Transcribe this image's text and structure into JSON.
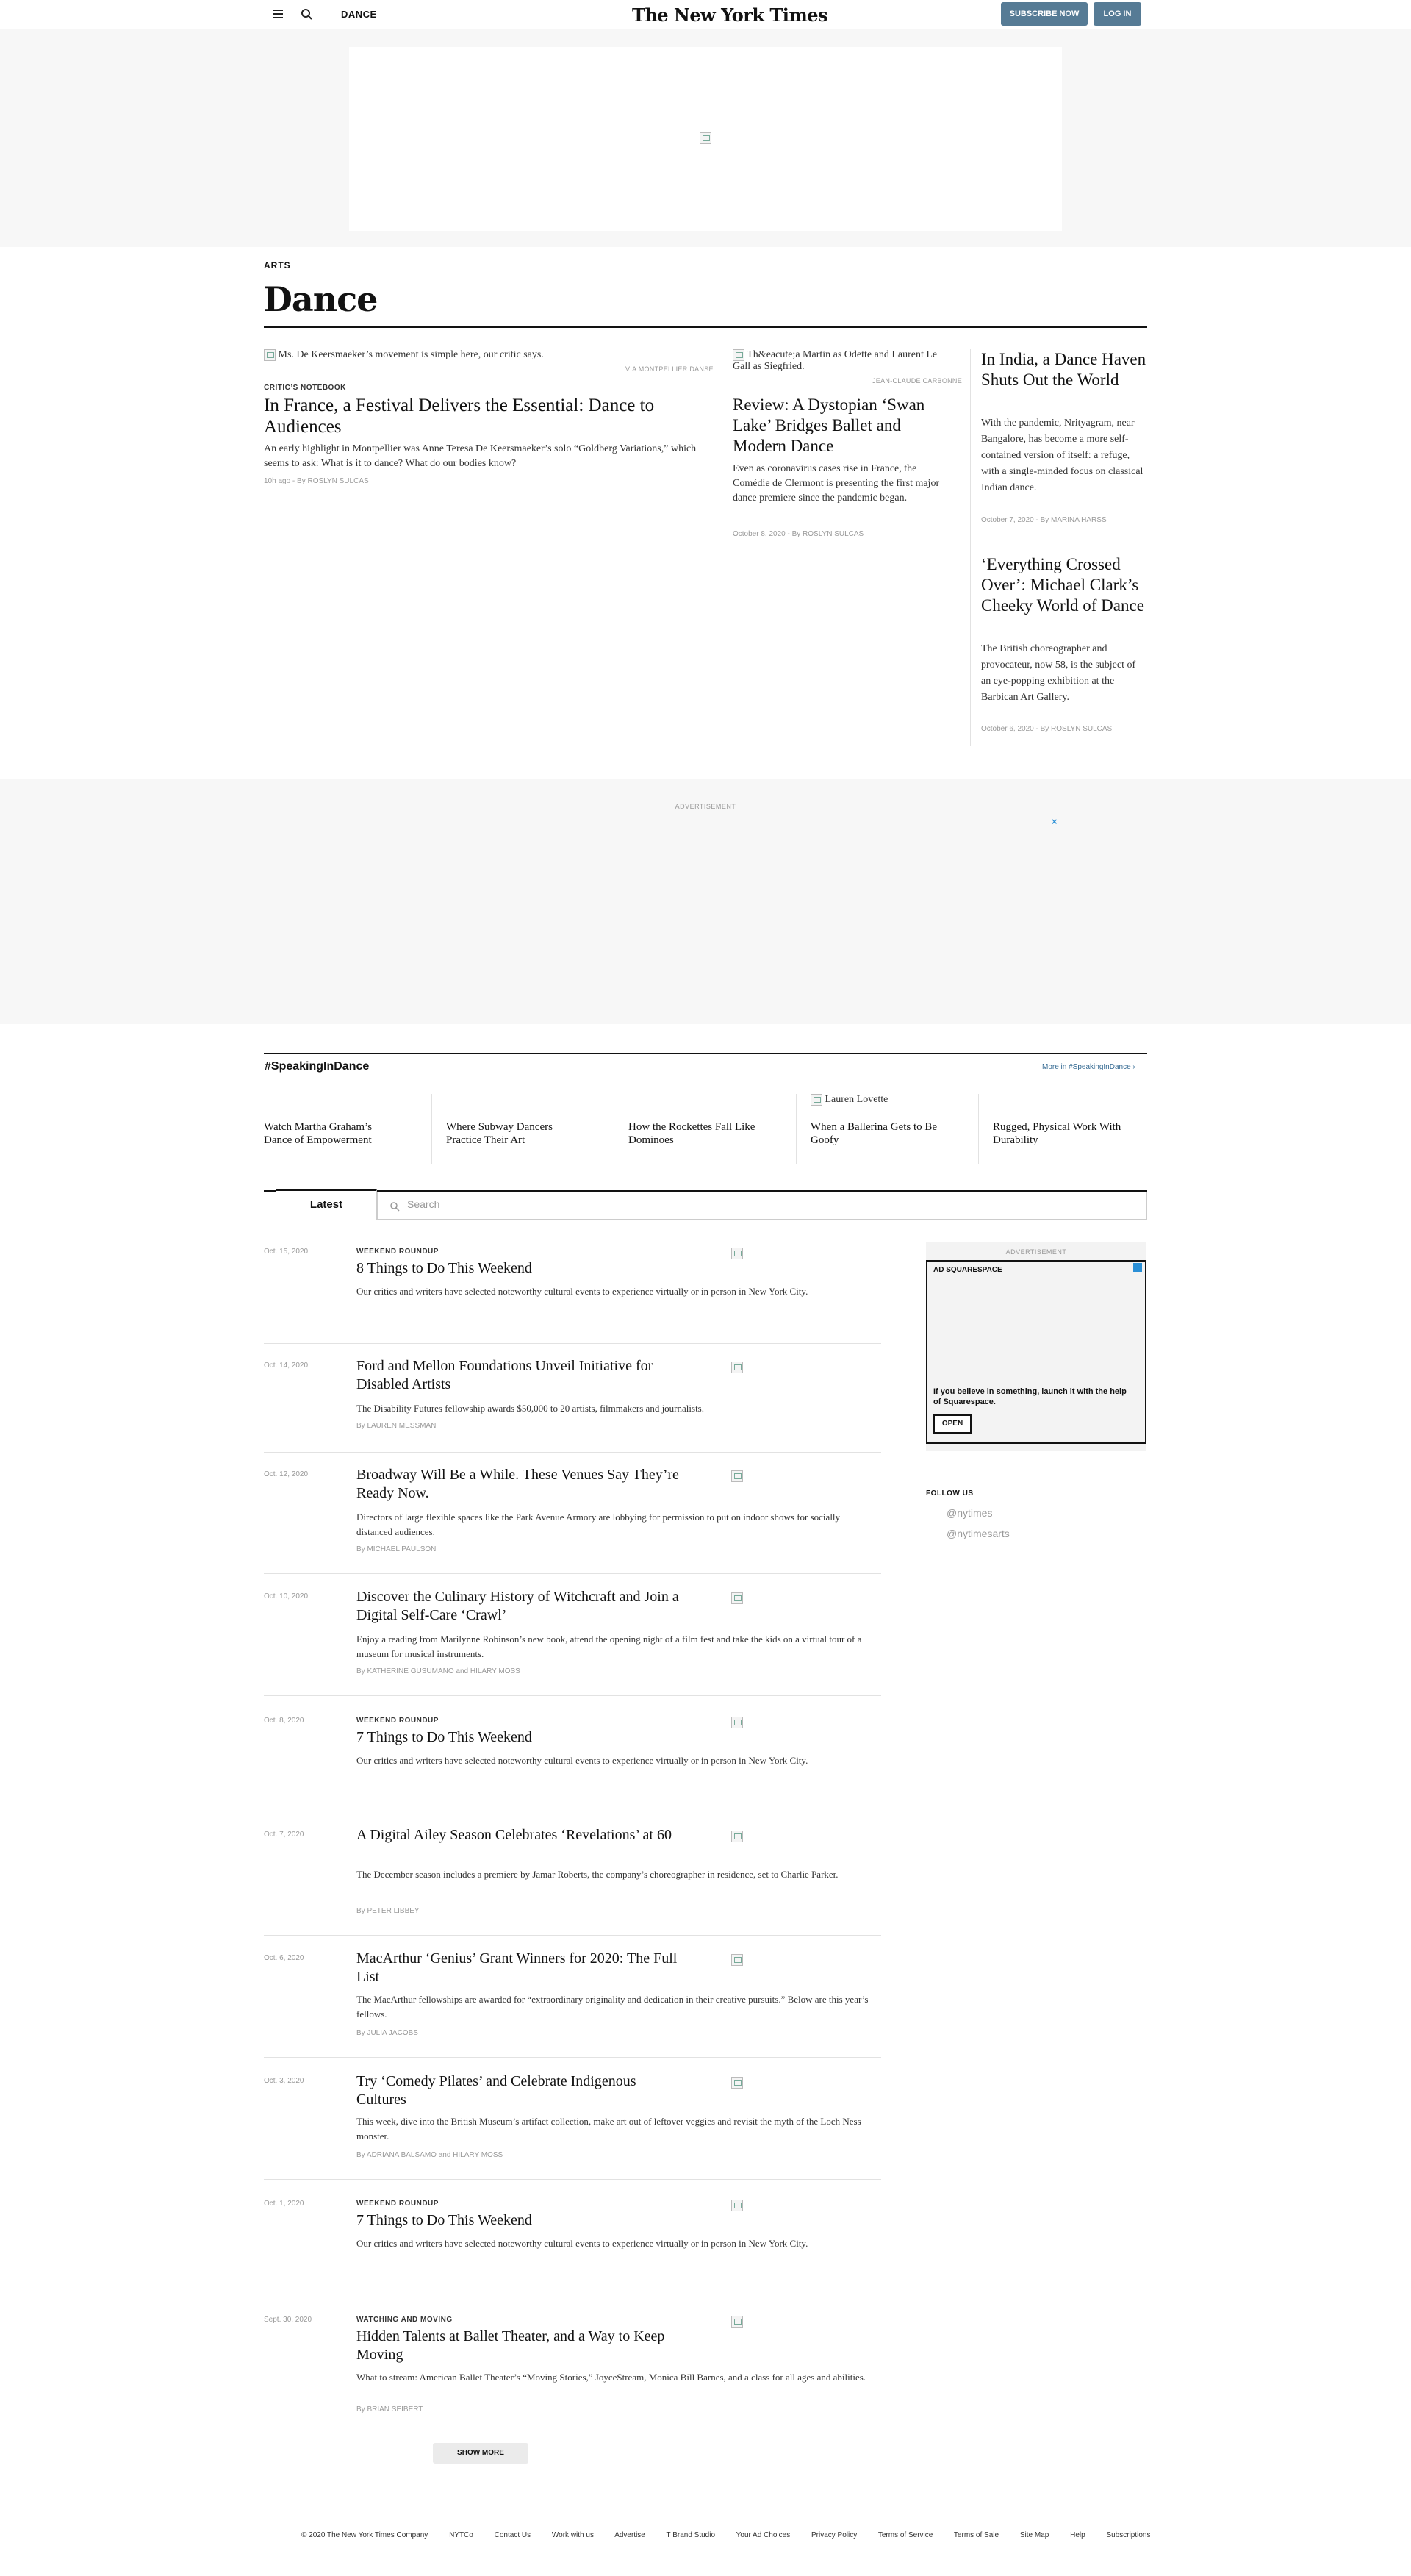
{
  "header": {
    "section": "DANCE",
    "logo": "The New York Times",
    "subscribe": "SUBSCRIBE NOW",
    "login": "LOG IN"
  },
  "page": {
    "kicker": "ARTS",
    "title": "Dance"
  },
  "lede": {
    "main": {
      "img_alt": "Ms. De Keersmaeker’s movement is simple here, our critic says.",
      "credit": "VIA MONTPELLIER DANSE",
      "label": "CRITIC’S NOTEBOOK",
      "title": "In France, a Festival Delivers the Essential: Dance to Audiences",
      "summary": "An early highlight in Montpellier was Anne Teresa De Keersmaeker’s solo “Goldberg Variations,” which seems to ask: What is it to dance? What do our bodies know?",
      "byline": "10h ago  -  By ROSLYN SULCAS"
    },
    "second": {
      "img_alt": "Th&eacute;a Martin as Odette and Laurent Le Gall as Siegfried.",
      "credit": "JEAN-CLAUDE CARBONNE",
      "title": "Review: A Dystopian ‘Swan Lake’ Bridges Ballet and Modern Dance",
      "summary": "Even as coronavirus cases rise in France, the Comédie de Clermont is presenting the first major dance premiere since the pandemic began.",
      "byline": "October 8, 2020  -  By ROSLYN SULCAS"
    },
    "third": {
      "title": "In India, a Dance Haven Shuts Out the World",
      "summary": "With the pandemic, Nrityagram, near Bangalore, has become a more self-contained version of itself: a refuge, with a single-minded focus on classical Indian dance.",
      "byline": "October 7, 2020  -  By MARINA HARSS"
    },
    "fourth": {
      "title": "‘Everything Crossed Over’: Michael Clark’s Cheeky World of Dance",
      "summary": "The British choreographer and provocateur, now 58, is the subject of an eye-popping exhibition at the Barbican Art Gallery.",
      "byline": "October 6, 2020  -  By ROSLYN SULCAS"
    }
  },
  "ad_band": {
    "label": "ADVERTISEMENT",
    "close": "×"
  },
  "speaking": {
    "title": "#SpeakingInDance",
    "more": "More in #SpeakingInDance ›",
    "items": [
      {
        "title": "Watch Martha Graham’s Dance of Empowerment",
        "img_alt": ""
      },
      {
        "title": "Where Subway Dancers Practice Their Art",
        "img_alt": ""
      },
      {
        "title": "How the Rockettes Fall Like Dominoes",
        "img_alt": ""
      },
      {
        "title": "When a Ballerina Gets to Be Goofy",
        "img_alt": "Lauren Lovette"
      },
      {
        "title": "Rugged, Physical Work With Durability",
        "img_alt": ""
      }
    ]
  },
  "tabs": {
    "latest": "Latest",
    "search_placeholder": "Search"
  },
  "articles": [
    {
      "date": "Oct. 15, 2020",
      "label": "WEEKEND ROUNDUP",
      "title": "8 Things to Do This Weekend",
      "summary": "Our critics and writers have selected noteworthy cultural events to experience virtually or in person in New York City.",
      "byline": ""
    },
    {
      "date": "Oct. 14, 2020",
      "label": "",
      "title": "Ford and Mellon Foundations Unveil Initiative for Disabled Artists",
      "summary": "The Disability Futures fellowship awards $50,000 to 20 artists, filmmakers and journalists.",
      "byline": "By LAUREN MESSMAN"
    },
    {
      "date": "Oct. 12, 2020",
      "label": "",
      "title": "Broadway Will Be a While. These Venues Say They’re Ready Now.",
      "summary": "Directors of large flexible spaces like the Park Avenue Armory are lobbying for permission to put on indoor shows for socially distanced audiences.",
      "byline": "By MICHAEL PAULSON"
    },
    {
      "date": "Oct. 10, 2020",
      "label": "",
      "title": "Discover the Culinary History of Witchcraft and Join a Digital Self-Care ‘Crawl’",
      "summary": "Enjoy a reading from Marilynne Robinson’s new book, attend the opening night of a film fest and take the kids on a virtual tour of a museum for musical instruments.",
      "byline": "By KATHERINE GUSUMANO and HILARY MOSS"
    },
    {
      "date": "Oct. 8, 2020",
      "label": "WEEKEND ROUNDUP",
      "title": "7 Things to Do This Weekend",
      "summary": "Our critics and writers have selected noteworthy cultural events to experience virtually or in person in New York City.",
      "byline": ""
    },
    {
      "date": "Oct. 7, 2020",
      "label": "",
      "title": "A Digital Ailey Season Celebrates ‘Revelations’ at 60",
      "summary": "The December season includes a premiere by Jamar Roberts, the company’s choreographer in residence, set to Charlie Parker.",
      "byline": "By PETER LIBBEY"
    },
    {
      "date": "Oct. 6, 2020",
      "label": "",
      "title": "MacArthur ‘Genius’ Grant Winners for 2020: The Full List",
      "summary": "The MacArthur fellowships are awarded for “extraordinary originality and dedication in their creative pursuits.” Below are this year’s fellows.",
      "byline": "By JULIA JACOBS"
    },
    {
      "date": "Oct. 3, 2020",
      "label": "",
      "title": "Try ‘Comedy Pilates’ and Celebrate Indigenous Cultures",
      "summary": "This week, dive into the British Museum’s artifact collection, make art out of leftover veggies and revisit the myth of the Loch Ness monster.",
      "byline": "By ADRIANA BALSAMO and HILARY MOSS"
    },
    {
      "date": "Oct. 1, 2020",
      "label": "WEEKEND ROUNDUP",
      "title": "7 Things to Do This Weekend",
      "summary": "Our critics and writers have selected noteworthy cultural events to experience virtually or in person in New York City.",
      "byline": ""
    },
    {
      "date": "Sept. 30, 2020",
      "label": "WATCHING AND MOVING",
      "title": "Hidden Talents at Ballet Theater, and a Way to Keep Moving",
      "summary": "What to stream: American Ballet Theater’s “Moving Stories,” JoyceStream, Monica Bill Barnes, and a class for all ages and abilities.",
      "byline": "By BRIAN SEIBERT"
    }
  ],
  "sidebar": {
    "ad_label": "ADVERTISEMENT",
    "ad_header": "AD  SQUARESPACE",
    "ad_copy": "If you believe in something, launch it with the help of Squarespace.",
    "ad_open": "OPEN",
    "follow": "FOLLOW US",
    "handles": [
      "@nytimes",
      "@nytimesarts"
    ]
  },
  "show_more": "SHOW MORE",
  "footer": {
    "links": [
      "© 2020 The New York Times Company",
      "NYTCo",
      "Contact Us",
      "Work with us",
      "Advertise",
      "T Brand Studio",
      "Your Ad Choices",
      "Privacy Policy",
      "Terms of Service",
      "Terms of Sale",
      "Site Map",
      "Help",
      "Subscriptions"
    ]
  }
}
